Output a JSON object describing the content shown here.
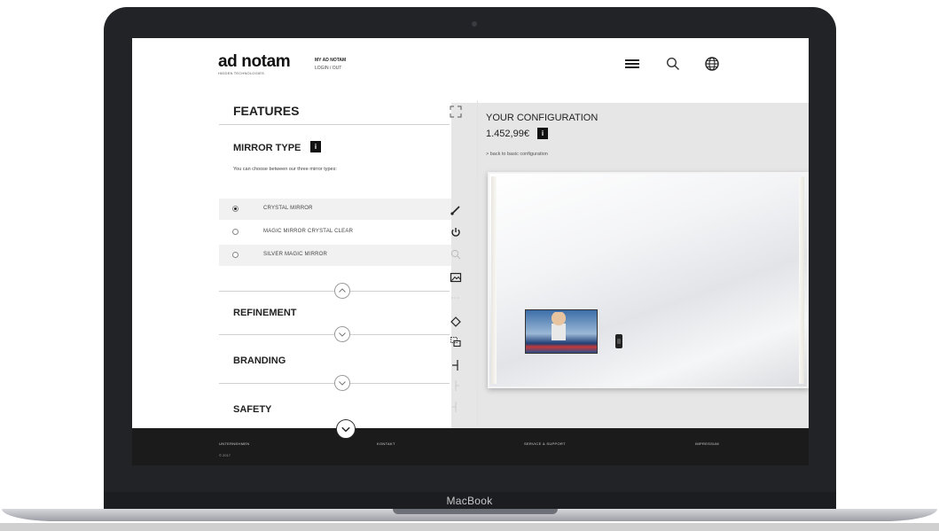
{
  "device": {
    "brand_label": "MacBook"
  },
  "header": {
    "logo_text": "ad notam",
    "logo_tagline": "HIDDEN TECHNOLOGIES",
    "my_account_label": "MY AD NOTAM",
    "login_label": "LOGIN / OUT",
    "icons": [
      "menu-icon",
      "search-icon",
      "globe-icon"
    ]
  },
  "features": {
    "title": "FEATURES",
    "mirror_type": {
      "title": "MIRROR TYPE",
      "info_badge": "i",
      "description": "You can choose between our three mirror types:",
      "options": [
        {
          "label": "CRYSTAL MIRROR",
          "selected": true
        },
        {
          "label": "MAGIC MIRROR CRYSTAL CLEAR",
          "selected": false
        },
        {
          "label": "SILVER MAGIC MIRROR",
          "selected": false
        }
      ]
    },
    "sections": [
      {
        "title": "REFINEMENT"
      },
      {
        "title": "BRANDING"
      },
      {
        "title": "SAFETY"
      }
    ]
  },
  "toolbar": {
    "icons": [
      "expand-icon",
      "brush-icon",
      "power-icon",
      "zoom-icon",
      "image-icon",
      "dash-icon",
      "move-icon",
      "copy-icon",
      "align-icon",
      "line-icon",
      "line-icon"
    ]
  },
  "configuration": {
    "title": "YOUR CONFIGURATION",
    "price": "1.452,99€",
    "info_badge": "i",
    "back_link": "> back to basic configuration"
  },
  "footer": {
    "items": [
      "UNTERNEHMEN",
      "KONTAKT",
      "SERVICE & SUPPORT",
      "IMPRESSUM"
    ],
    "copyright": "© 2017"
  },
  "colors": {
    "accent": "#111111",
    "panel_bg": "#e6e6e6",
    "footer_bg": "#1b1b1b"
  }
}
